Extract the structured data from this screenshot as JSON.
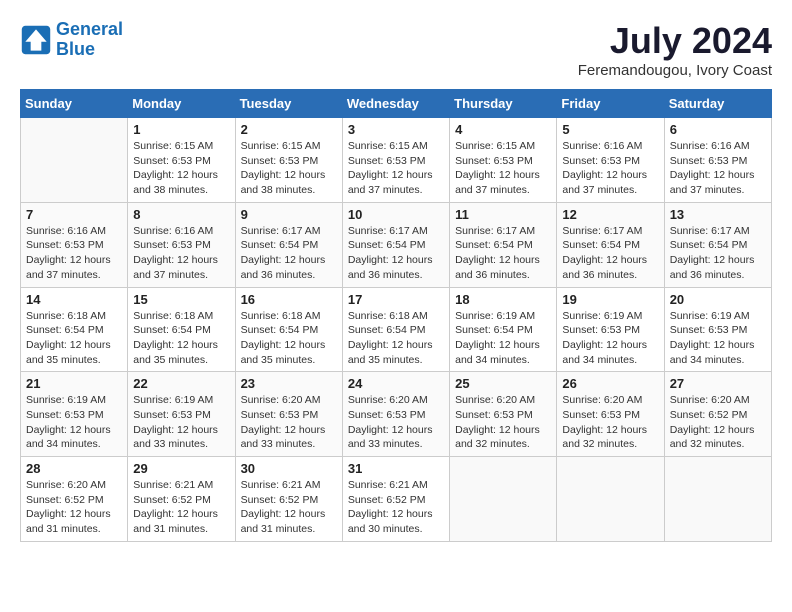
{
  "header": {
    "logo_line1": "General",
    "logo_line2": "Blue",
    "month_title": "July 2024",
    "location": "Feremandougou, Ivory Coast"
  },
  "days_of_week": [
    "Sunday",
    "Monday",
    "Tuesday",
    "Wednesday",
    "Thursday",
    "Friday",
    "Saturday"
  ],
  "weeks": [
    [
      {
        "day": "",
        "info": ""
      },
      {
        "day": "1",
        "info": "Sunrise: 6:15 AM\nSunset: 6:53 PM\nDaylight: 12 hours and 38 minutes."
      },
      {
        "day": "2",
        "info": "Sunrise: 6:15 AM\nSunset: 6:53 PM\nDaylight: 12 hours and 38 minutes."
      },
      {
        "day": "3",
        "info": "Sunrise: 6:15 AM\nSunset: 6:53 PM\nDaylight: 12 hours and 37 minutes."
      },
      {
        "day": "4",
        "info": "Sunrise: 6:15 AM\nSunset: 6:53 PM\nDaylight: 12 hours and 37 minutes."
      },
      {
        "day": "5",
        "info": "Sunrise: 6:16 AM\nSunset: 6:53 PM\nDaylight: 12 hours and 37 minutes."
      },
      {
        "day": "6",
        "info": "Sunrise: 6:16 AM\nSunset: 6:53 PM\nDaylight: 12 hours and 37 minutes."
      }
    ],
    [
      {
        "day": "7",
        "info": "Sunrise: 6:16 AM\nSunset: 6:53 PM\nDaylight: 12 hours and 37 minutes."
      },
      {
        "day": "8",
        "info": "Sunrise: 6:16 AM\nSunset: 6:53 PM\nDaylight: 12 hours and 37 minutes."
      },
      {
        "day": "9",
        "info": "Sunrise: 6:17 AM\nSunset: 6:54 PM\nDaylight: 12 hours and 36 minutes."
      },
      {
        "day": "10",
        "info": "Sunrise: 6:17 AM\nSunset: 6:54 PM\nDaylight: 12 hours and 36 minutes."
      },
      {
        "day": "11",
        "info": "Sunrise: 6:17 AM\nSunset: 6:54 PM\nDaylight: 12 hours and 36 minutes."
      },
      {
        "day": "12",
        "info": "Sunrise: 6:17 AM\nSunset: 6:54 PM\nDaylight: 12 hours and 36 minutes."
      },
      {
        "day": "13",
        "info": "Sunrise: 6:17 AM\nSunset: 6:54 PM\nDaylight: 12 hours and 36 minutes."
      }
    ],
    [
      {
        "day": "14",
        "info": "Sunrise: 6:18 AM\nSunset: 6:54 PM\nDaylight: 12 hours and 35 minutes."
      },
      {
        "day": "15",
        "info": "Sunrise: 6:18 AM\nSunset: 6:54 PM\nDaylight: 12 hours and 35 minutes."
      },
      {
        "day": "16",
        "info": "Sunrise: 6:18 AM\nSunset: 6:54 PM\nDaylight: 12 hours and 35 minutes."
      },
      {
        "day": "17",
        "info": "Sunrise: 6:18 AM\nSunset: 6:54 PM\nDaylight: 12 hours and 35 minutes."
      },
      {
        "day": "18",
        "info": "Sunrise: 6:19 AM\nSunset: 6:54 PM\nDaylight: 12 hours and 34 minutes."
      },
      {
        "day": "19",
        "info": "Sunrise: 6:19 AM\nSunset: 6:53 PM\nDaylight: 12 hours and 34 minutes."
      },
      {
        "day": "20",
        "info": "Sunrise: 6:19 AM\nSunset: 6:53 PM\nDaylight: 12 hours and 34 minutes."
      }
    ],
    [
      {
        "day": "21",
        "info": "Sunrise: 6:19 AM\nSunset: 6:53 PM\nDaylight: 12 hours and 34 minutes."
      },
      {
        "day": "22",
        "info": "Sunrise: 6:19 AM\nSunset: 6:53 PM\nDaylight: 12 hours and 33 minutes."
      },
      {
        "day": "23",
        "info": "Sunrise: 6:20 AM\nSunset: 6:53 PM\nDaylight: 12 hours and 33 minutes."
      },
      {
        "day": "24",
        "info": "Sunrise: 6:20 AM\nSunset: 6:53 PM\nDaylight: 12 hours and 33 minutes."
      },
      {
        "day": "25",
        "info": "Sunrise: 6:20 AM\nSunset: 6:53 PM\nDaylight: 12 hours and 32 minutes."
      },
      {
        "day": "26",
        "info": "Sunrise: 6:20 AM\nSunset: 6:53 PM\nDaylight: 12 hours and 32 minutes."
      },
      {
        "day": "27",
        "info": "Sunrise: 6:20 AM\nSunset: 6:52 PM\nDaylight: 12 hours and 32 minutes."
      }
    ],
    [
      {
        "day": "28",
        "info": "Sunrise: 6:20 AM\nSunset: 6:52 PM\nDaylight: 12 hours and 31 minutes."
      },
      {
        "day": "29",
        "info": "Sunrise: 6:21 AM\nSunset: 6:52 PM\nDaylight: 12 hours and 31 minutes."
      },
      {
        "day": "30",
        "info": "Sunrise: 6:21 AM\nSunset: 6:52 PM\nDaylight: 12 hours and 31 minutes."
      },
      {
        "day": "31",
        "info": "Sunrise: 6:21 AM\nSunset: 6:52 PM\nDaylight: 12 hours and 30 minutes."
      },
      {
        "day": "",
        "info": ""
      },
      {
        "day": "",
        "info": ""
      },
      {
        "day": "",
        "info": ""
      }
    ]
  ]
}
